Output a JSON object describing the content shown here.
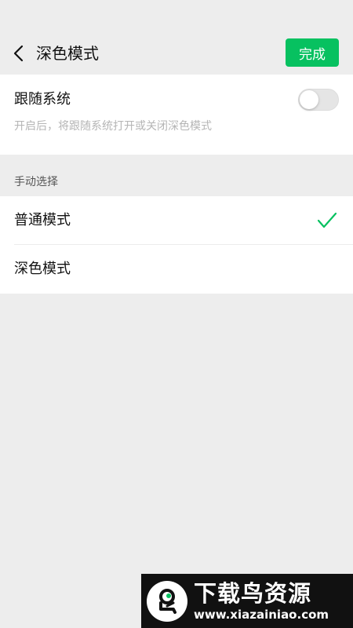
{
  "header": {
    "title": "深色模式",
    "back_icon": "chevron-left-icon",
    "done_label": "完成"
  },
  "follow_system": {
    "label": "跟随系统",
    "description": "开启后，将跟随系统打开或关闭深色模式",
    "enabled": false
  },
  "manual": {
    "section_title": "手动选择",
    "options": [
      {
        "label": "普通模式",
        "selected": true
      },
      {
        "label": "深色模式",
        "selected": false
      }
    ]
  },
  "watermark": {
    "title": "下载鸟资源",
    "url": "www.xiazainiao.com"
  },
  "colors": {
    "accent": "#07c160",
    "background": "#ededed",
    "card": "#ffffff",
    "secondary_text": "#b5b5b5"
  }
}
